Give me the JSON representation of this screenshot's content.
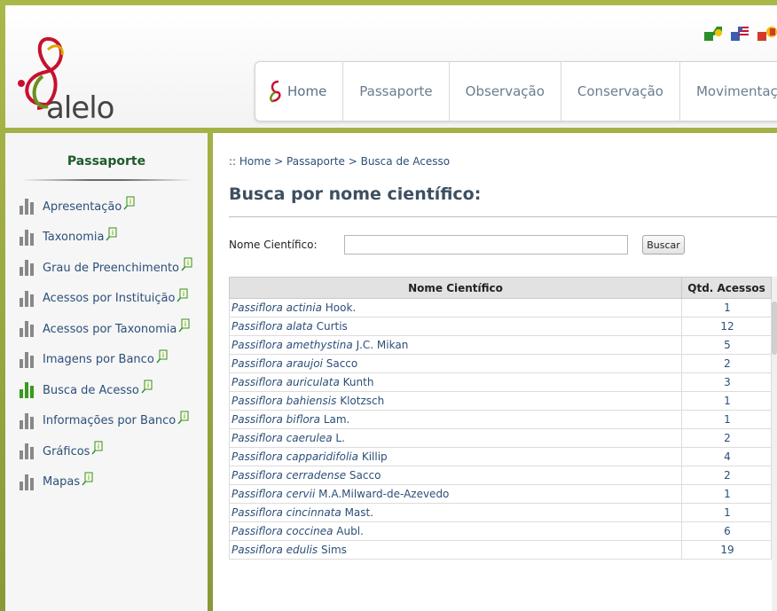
{
  "logo": {
    "text": "alelo"
  },
  "languages": [
    {
      "code": "PT",
      "color": "#2a8f2a"
    },
    {
      "code": "EN",
      "color": "#3a5fb0"
    },
    {
      "code": "ES",
      "color": "#d23a2a"
    }
  ],
  "nav": {
    "items": [
      "Home",
      "Passaporte",
      "Observação",
      "Conservação",
      "Movimentação"
    ]
  },
  "sidebar": {
    "title": "Passaporte",
    "items": [
      {
        "label": "Apresentação",
        "active": false
      },
      {
        "label": "Taxonomia",
        "active": false
      },
      {
        "label": "Grau de Preenchimento",
        "active": false
      },
      {
        "label": "Acessos por Instituição",
        "active": false
      },
      {
        "label": "Acessos por Taxonomia",
        "active": false
      },
      {
        "label": "Imagens por Banco",
        "active": false
      },
      {
        "label": "Busca de Acesso",
        "active": true
      },
      {
        "label": "Informações por Banco",
        "active": false
      },
      {
        "label": "Gráficos",
        "active": false
      },
      {
        "label": "Mapas",
        "active": false
      }
    ]
  },
  "main": {
    "breadcrumb": ":: Home > Passaporte > Busca de Acesso",
    "title": "Busca por nome científico:",
    "search": {
      "label": "Nome Científico:",
      "value": "",
      "button": "Buscar"
    },
    "table": {
      "headers": [
        "Nome Científico",
        "Qtd. Acessos"
      ],
      "rows": [
        {
          "genus": "Passiflora",
          "species": "actinia",
          "author": "Hook.",
          "count": "1"
        },
        {
          "genus": "Passiflora",
          "species": "alata",
          "author": "Curtis",
          "count": "12"
        },
        {
          "genus": "Passiflora",
          "species": "amethystina",
          "author": "J.C. Mikan",
          "count": "5"
        },
        {
          "genus": "Passiflora",
          "species": "araujoi",
          "author": "Sacco",
          "count": "2"
        },
        {
          "genus": "Passiflora",
          "species": "auriculata",
          "author": "Kunth",
          "count": "3"
        },
        {
          "genus": "Passiflora",
          "species": "bahiensis",
          "author": "Klotzsch",
          "count": "1"
        },
        {
          "genus": "Passiflora",
          "species": "biflora",
          "author": "Lam.",
          "count": "1"
        },
        {
          "genus": "Passiflora",
          "species": "caerulea",
          "author": "L.",
          "count": "2"
        },
        {
          "genus": "Passiflora",
          "species": "capparidifolia",
          "author": "Killip",
          "count": "4"
        },
        {
          "genus": "Passiflora",
          "species": "cerradense",
          "author": "Sacco",
          "count": "2"
        },
        {
          "genus": "Passiflora",
          "species": "cervii",
          "author": "M.A.Milward-de-Azevedo",
          "count": "1"
        },
        {
          "genus": "Passiflora",
          "species": "cincinnata",
          "author": "Mast.",
          "count": "1"
        },
        {
          "genus": "Passiflora",
          "species": "coccinea",
          "author": "Aubl.",
          "count": "6"
        },
        {
          "genus": "Passiflora",
          "species": "edulis",
          "author": "Sims",
          "count": "19"
        }
      ]
    }
  },
  "colors": {
    "border": "#9aa842",
    "link": "#2c4f79",
    "active_icon": "#3a9a1e",
    "sidebar_title": "#1e5a2a"
  }
}
